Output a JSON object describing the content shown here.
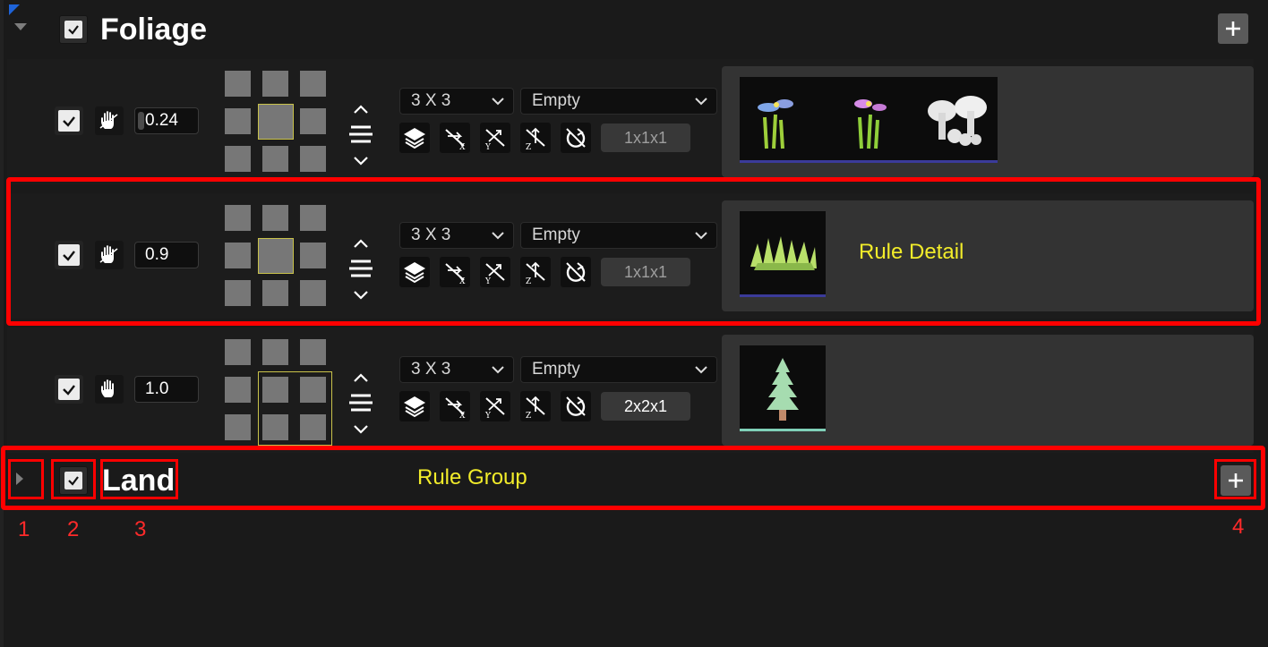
{
  "groups": {
    "foliage": {
      "title": "Foliage",
      "checked": true
    },
    "land": {
      "title": "Land",
      "checked": true
    }
  },
  "rules": [
    {
      "weight": "0.24",
      "grid_dropdown": "3 X 3",
      "type_dropdown": "Empty",
      "grid_size": "1x1x1"
    },
    {
      "weight": "0.9",
      "grid_dropdown": "3 X 3",
      "type_dropdown": "Empty",
      "grid_size": "1x1x1"
    },
    {
      "weight": "1.0",
      "grid_dropdown": "3 X 3",
      "type_dropdown": "Empty",
      "grid_size": "2x2x1"
    }
  ],
  "annotations": {
    "rule_detail": "Rule Detail",
    "rule_group": "Rule Group",
    "markers": [
      "1",
      "2",
      "3",
      "4"
    ]
  },
  "icons": {
    "collapse": "chevron-down-icon",
    "expand": "chevron-right-icon",
    "add": "plus-icon",
    "hand": "hand-icon",
    "layers": "layers-icon",
    "flip_x": "flip-x-icon",
    "flip_y": "flip-y-icon",
    "flip_z": "flip-z-icon",
    "rotate": "no-rotate-icon"
  },
  "colors": {
    "annotation_yellow": "#f2ec2a",
    "annotation_red": "#ff0000",
    "highlight_cell": "#c9c24a"
  }
}
